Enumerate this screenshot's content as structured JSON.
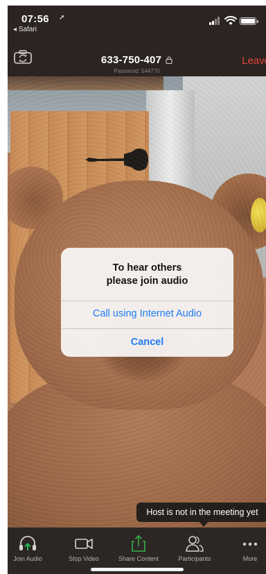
{
  "status_bar": {
    "time": "07:56",
    "location_glyph": "➚",
    "back_app": "◂ Safari"
  },
  "meeting": {
    "id": "633-750-407",
    "password": "Password: 544770",
    "leave_label": "Leave"
  },
  "dialog": {
    "title_line1": "To hear others",
    "title_line2": "please join audio",
    "internet_audio_label": "Call using Internet Audio",
    "cancel_label": "Cancel"
  },
  "tooltip": {
    "text": "Host is not in the meeting yet"
  },
  "toolbar": {
    "join_audio": "Join Audio",
    "stop_video": "Stop Video",
    "share_content": "Share Content",
    "participants": "Participants",
    "more": "More"
  },
  "colors": {
    "leave": "#e34537",
    "dialog_button": "#1f7bf2",
    "join_audio_accent": "#28b75a",
    "share_accent": "#34b24a",
    "toolbar_bg": "#2c2624"
  },
  "icons": {
    "camera_switch": "camera-switch-icon",
    "lock": "lock-icon",
    "join_audio": "headphones-icon",
    "stop_video": "video-camera-icon",
    "share_content": "share-upload-icon",
    "participants": "participants-icon",
    "more": "more-dots-icon"
  }
}
